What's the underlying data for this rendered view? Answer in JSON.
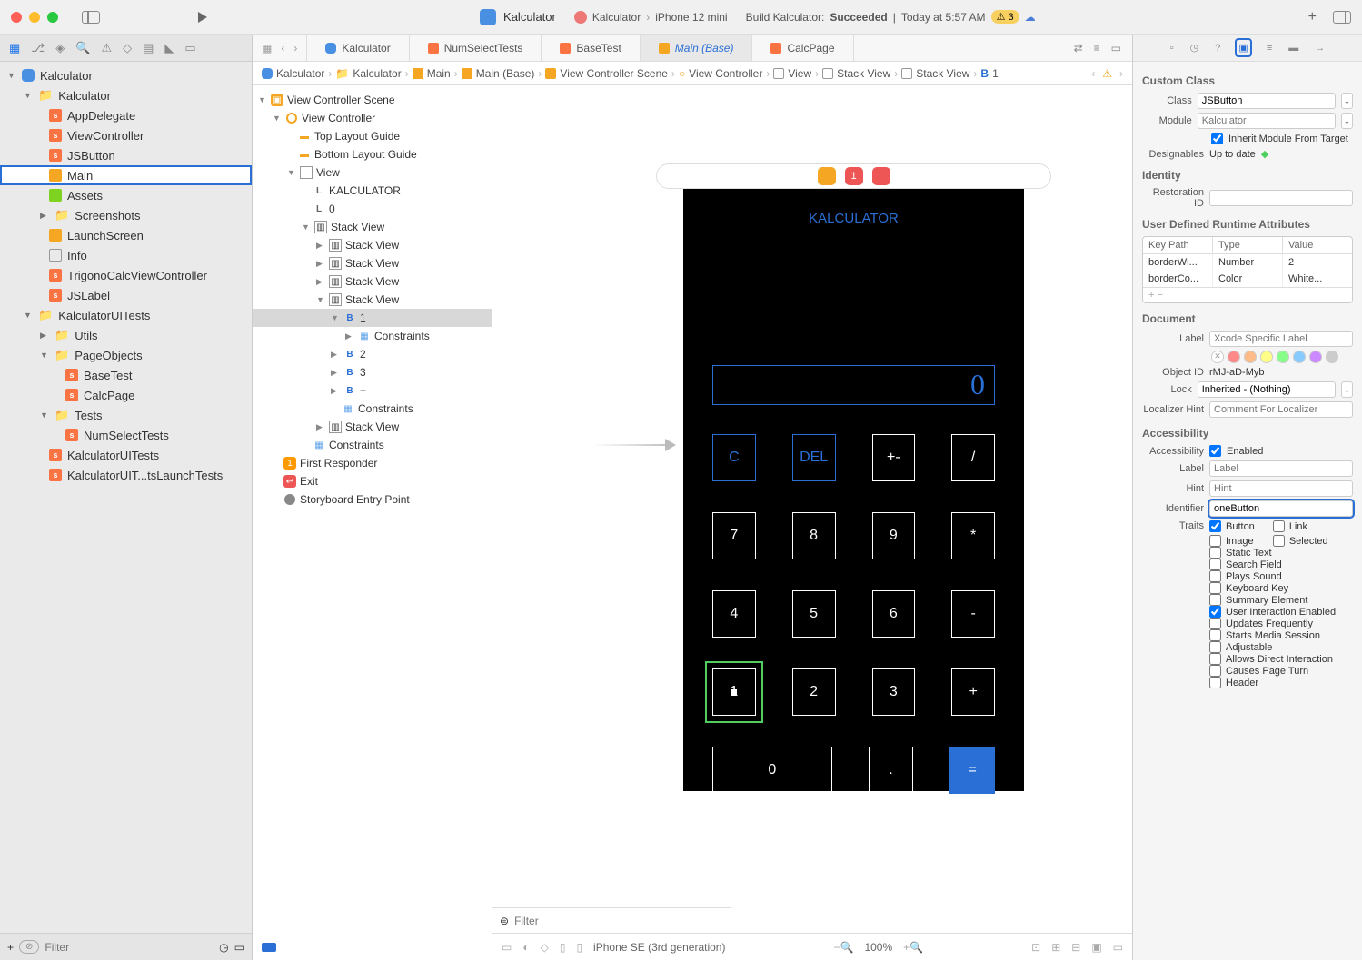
{
  "titlebar": {
    "project": "Kalculator",
    "scheme_app": "Kalculator",
    "scheme_device": "iPhone 12 mini",
    "build_status_prefix": "Build Kalculator:",
    "build_status_result": "Succeeded",
    "build_status_time": "Today at 5:57 AM",
    "warnings": "3"
  },
  "navigator": {
    "filter_placeholder": "Filter",
    "tree": {
      "root": "Kalculator",
      "group_app": "Kalculator",
      "appdelegate": "AppDelegate",
      "viewcontroller": "ViewController",
      "jsbutton": "JSButton",
      "main": "Main",
      "assets": "Assets",
      "screenshots": "Screenshots",
      "launchscreen": "LaunchScreen",
      "info": "Info",
      "trigono": "TrigonoCalcViewController",
      "jslabel": "JSLabel",
      "uitests": "KalculatorUITests",
      "utils": "Utils",
      "pageobjects": "PageObjects",
      "basetest": "BaseTest",
      "calcpage": "CalcPage",
      "tests": "Tests",
      "numselecttests": "NumSelectTests",
      "kalculatoruitests_file": "KalculatorUITests",
      "launchtests": "KalculatorUIT...tsLaunchTests"
    }
  },
  "tabs": {
    "t1": "Kalculator",
    "t2": "NumSelectTests",
    "t3": "BaseTest",
    "t4": "Main (Base)",
    "t5": "CalcPage"
  },
  "breadcrumb": {
    "c1": "Kalculator",
    "c2": "Kalculator",
    "c3": "Main",
    "c4": "Main (Base)",
    "c5": "View Controller Scene",
    "c6": "View Controller",
    "c7": "View",
    "c8": "Stack View",
    "c9": "Stack View",
    "c10": "1"
  },
  "outline": {
    "scene": "View Controller Scene",
    "vc": "View Controller",
    "top_guide": "Top Layout Guide",
    "bottom_guide": "Bottom Layout Guide",
    "view": "View",
    "label_kalc": "KALCULATOR",
    "label_zero": "0",
    "stackview": "Stack View",
    "btn1": "1",
    "constraints": "Constraints",
    "btn2": "2",
    "btn3": "3",
    "btnplus": "+",
    "first_responder": "First Responder",
    "exit": "Exit",
    "entry": "Storyboard Entry Point",
    "filter_placeholder": "Filter"
  },
  "device": {
    "title": "KALCULATOR",
    "display": "0",
    "header_badge": "1",
    "buttons": {
      "c": "C",
      "del": "DEL",
      "pm": "+-",
      "div": "/",
      "7": "7",
      "8": "8",
      "9": "9",
      "mul": "*",
      "4": "4",
      "5": "5",
      "6": "6",
      "sub": "-",
      "1": "1",
      "2": "2",
      "3": "3",
      "add": "+",
      "0": "0",
      "dot": ".",
      "eq": "="
    }
  },
  "canvas_bottom": {
    "device": "iPhone SE (3rd generation)",
    "zoom": "100%"
  },
  "inspector": {
    "section_custom_class": "Custom Class",
    "class_label": "Class",
    "class_value": "JSButton",
    "module_label": "Module",
    "module_placeholder": "Kalculator",
    "inherit_module": "Inherit Module From Target",
    "designables_label": "Designables",
    "designables_value": "Up to date",
    "section_identity": "Identity",
    "restoration_label": "Restoration ID",
    "section_udra": "User Defined Runtime Attributes",
    "udra_keypath": "Key Path",
    "udra_type": "Type",
    "udra_value": "Value",
    "udra_r1_key": "borderWi...",
    "udra_r1_type": "Number",
    "udra_r1_val": "2",
    "udra_r2_key": "borderCo...",
    "udra_r2_type": "Color",
    "udra_r2_val": "White...",
    "section_document": "Document",
    "doc_label_label": "Label",
    "doc_label_placeholder": "Xcode Specific Label",
    "object_id_label": "Object ID",
    "object_id_value": "rMJ-aD-Myb",
    "lock_label": "Lock",
    "lock_value": "Inherited - (Nothing)",
    "localizer_label": "Localizer Hint",
    "localizer_placeholder": "Comment For Localizer",
    "section_accessibility": "Accessibility",
    "acc_label": "Accessibility",
    "acc_enabled": "Enabled",
    "acc_label_label": "Label",
    "acc_label_placeholder": "Label",
    "acc_hint_label": "Hint",
    "acc_hint_placeholder": "Hint",
    "acc_identifier_label": "Identifier",
    "acc_identifier_value": "oneButton",
    "traits_label": "Traits",
    "traits": {
      "button": "Button",
      "link": "Link",
      "image": "Image",
      "selected": "Selected",
      "static_text": "Static Text",
      "search_field": "Search Field",
      "plays_sound": "Plays Sound",
      "keyboard_key": "Keyboard Key",
      "summary": "Summary Element",
      "user_interaction": "User Interaction Enabled",
      "updates": "Updates Frequently",
      "media": "Starts Media Session",
      "adjustable": "Adjustable",
      "direct": "Allows Direct Interaction",
      "page_turn": "Causes Page Turn",
      "header": "Header"
    }
  }
}
